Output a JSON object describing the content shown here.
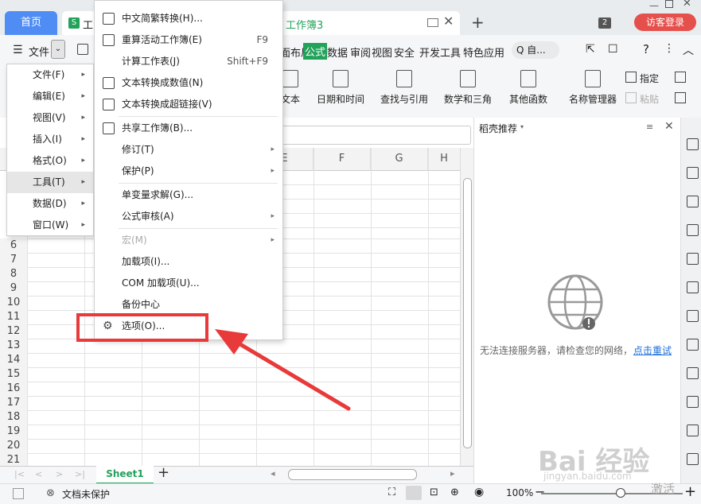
{
  "titlebar": {
    "home_tab": "首页",
    "doc_tab_icon": "S",
    "doc_tab": "工",
    "workbook_tab": "工作簿3",
    "window_count": "2",
    "guest_login": "访客登录"
  },
  "menubar": {
    "file": "文件",
    "tabs": [
      "面布局",
      "公式",
      "数据",
      "审阅",
      "视图",
      "安全",
      "开发工具",
      "特色应用"
    ],
    "search_placeholder": "Q 自..."
  },
  "ribbon": {
    "buttons": [
      "文本",
      "日期和时间",
      "查找与引用",
      "数学和三角",
      "其他函数",
      "名称管理器"
    ],
    "designate": "指定",
    "paste": "粘贴"
  },
  "grid": {
    "columns": [
      "E",
      "F",
      "G",
      "H"
    ],
    "rows": [
      "6",
      "7",
      "8",
      "9",
      "10",
      "11",
      "12",
      "13",
      "14",
      "15",
      "16",
      "17",
      "18",
      "19",
      "20",
      "21"
    ]
  },
  "file_menu": {
    "items": [
      {
        "label": "文件(F)",
        "arrow": "▸"
      },
      {
        "label": "编辑(E)",
        "arrow": "▸"
      },
      {
        "label": "视图(V)",
        "arrow": "▸"
      },
      {
        "label": "插入(I)",
        "arrow": "▸"
      },
      {
        "label": "格式(O)",
        "arrow": "▸"
      },
      {
        "label": "工具(T)",
        "arrow": "▸"
      },
      {
        "label": "数据(D)",
        "arrow": "▸"
      },
      {
        "label": "窗口(W)",
        "arrow": "▸"
      }
    ]
  },
  "tools_menu": {
    "items": [
      {
        "label": "中文简繁转换(H)...",
        "shortcut": "",
        "arrow": ""
      },
      {
        "label": "重算活动工作簿(E)",
        "shortcut": "F9",
        "arrow": ""
      },
      {
        "label": "计算工作表(J)",
        "shortcut": "Shift+F9",
        "arrow": ""
      },
      {
        "label": "文本转换成数值(N)",
        "shortcut": "",
        "arrow": ""
      },
      {
        "label": "文本转换成超链接(V)",
        "shortcut": "",
        "arrow": ""
      },
      {
        "label": "共享工作簿(B)...",
        "shortcut": "",
        "arrow": ""
      },
      {
        "label": "修订(T)",
        "shortcut": "",
        "arrow": "▸"
      },
      {
        "label": "保护(P)",
        "shortcut": "",
        "arrow": "▸"
      },
      {
        "label": "单变量求解(G)...",
        "shortcut": "",
        "arrow": ""
      },
      {
        "label": "公式审核(A)",
        "shortcut": "",
        "arrow": "▸"
      },
      {
        "label": "宏(M)",
        "shortcut": "",
        "arrow": "▸"
      },
      {
        "label": "加载项(I)...",
        "shortcut": "",
        "arrow": ""
      },
      {
        "label": "COM 加载项(U)...",
        "shortcut": "",
        "arrow": ""
      },
      {
        "label": "备份中心",
        "shortcut": "",
        "arrow": ""
      },
      {
        "label": "选项(O)...",
        "shortcut": "",
        "arrow": ""
      }
    ]
  },
  "side_panel": {
    "title": "稻壳推荐",
    "message": "无法连接服务器，请检查您的网络，",
    "retry": "点击重试"
  },
  "sheets": {
    "active": "Sheet1"
  },
  "statusbar": {
    "protection": "文档未保护",
    "zoom": "100%"
  },
  "watermark": {
    "brand": "Bai  经验",
    "url": "jingyan.baidu.com",
    "activate": "激活"
  },
  "colors": {
    "accent_green": "#23a25a",
    "home_blue": "#4f8df5",
    "highlight_red": "#e83a3a",
    "guest_red": "#e5504c"
  }
}
